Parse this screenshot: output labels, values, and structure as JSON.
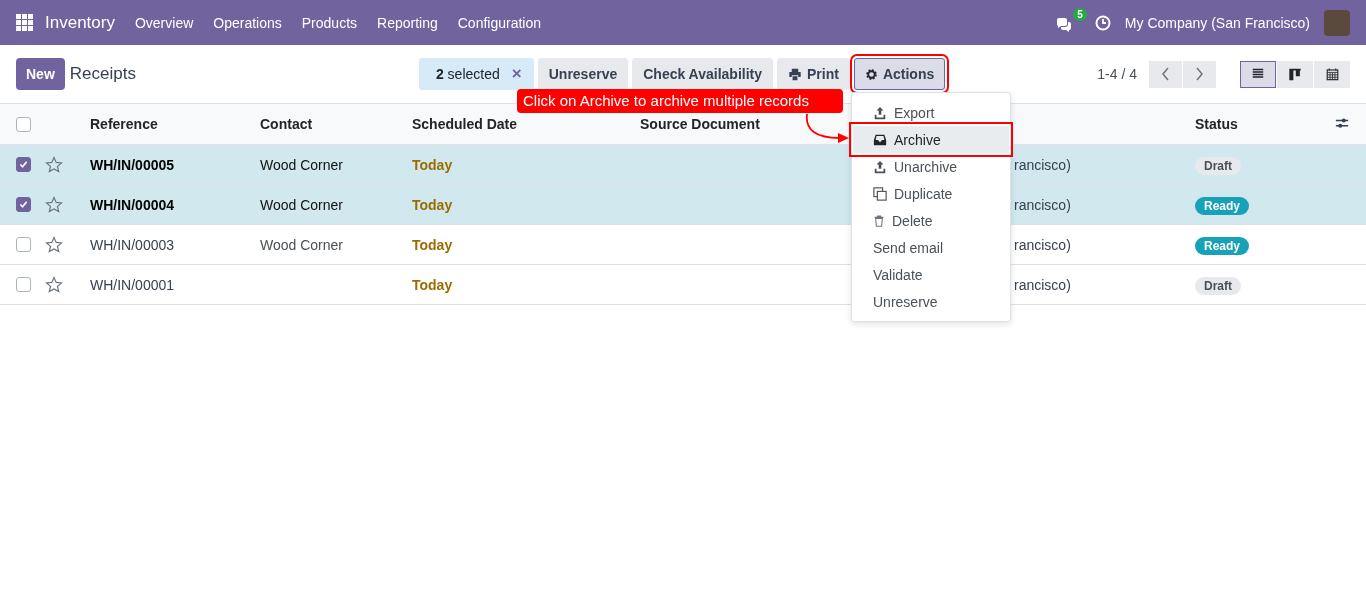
{
  "navbar": {
    "app": "Inventory",
    "menu": [
      "Overview",
      "Operations",
      "Products",
      "Reporting",
      "Configuration"
    ],
    "messages_count": "5",
    "company": "My Company (San Francisco)"
  },
  "toolbar": {
    "new_button": "New",
    "title": "Receipts",
    "selection": "**2** selected",
    "clear": "×",
    "buttons": [
      {
        "label": "Unreserve",
        "kind": "plain",
        "highlighted": false
      },
      {
        "label": "Check Availability",
        "kind": "plain",
        "highlighted": false
      },
      {
        "label": "Print",
        "kind": "print",
        "highlighted": false
      },
      {
        "label": "Actions",
        "kind": "gear",
        "highlighted": true
      }
    ],
    "pager": "1-4 / 4",
    "views": [
      {
        "kind": "list",
        "selected": true
      },
      {
        "kind": "kanban",
        "selected": false
      },
      {
        "kind": "calendar",
        "selected": false
      }
    ]
  },
  "table": {
    "all_checked": false,
    "columns": [
      "Reference",
      "Contact",
      "Scheduled Date",
      "Source Document",
      "Status"
    ],
    "rows": [
      {
        "selected": true,
        "reference": "WH/IN/00005",
        "contact": "Wood Corner",
        "scheduled_date": "Today",
        "column_5": "rancisco)",
        "status": {
          "label": "Draft",
          "kind": "draft"
        }
      },
      {
        "selected": true,
        "reference": "WH/IN/00004",
        "contact": "Wood Corner",
        "scheduled_date": "Today",
        "column_5": "rancisco)",
        "status": {
          "label": "Ready",
          "kind": "ready"
        }
      },
      {
        "selected": false,
        "reference": "WH/IN/00003",
        "contact": "Wood Corner",
        "scheduled_date": "Today",
        "column_5": "rancisco)",
        "status": {
          "label": "Ready",
          "kind": "ready"
        }
      },
      {
        "selected": false,
        "reference": "WH/IN/00001",
        "contact": "",
        "scheduled_date": "Today",
        "column_5": "rancisco)",
        "status": {
          "label": "Draft",
          "kind": "draft"
        }
      }
    ]
  },
  "actions_menu": [
    {
      "label": "Export",
      "kind": "upload",
      "selected": false,
      "highlighted": false
    },
    {
      "label": "Archive",
      "kind": "inbox",
      "selected": true,
      "highlighted": true
    },
    {
      "label": "Unarchive",
      "kind": "upload",
      "selected": false,
      "highlighted": false
    },
    {
      "label": "Duplicate",
      "kind": "copy",
      "selected": false,
      "highlighted": false
    },
    {
      "label": "Delete",
      "kind": "trash",
      "selected": false,
      "highlighted": false
    },
    {
      "label": "Send email",
      "kind": "text",
      "selected": false,
      "highlighted": false
    },
    {
      "label": "Validate",
      "kind": "text",
      "selected": false,
      "highlighted": false
    },
    {
      "label": "Unreserve",
      "kind": "text",
      "selected": false,
      "highlighted": false
    }
  ],
  "callout": "Click on Archive to archive multiple records"
}
